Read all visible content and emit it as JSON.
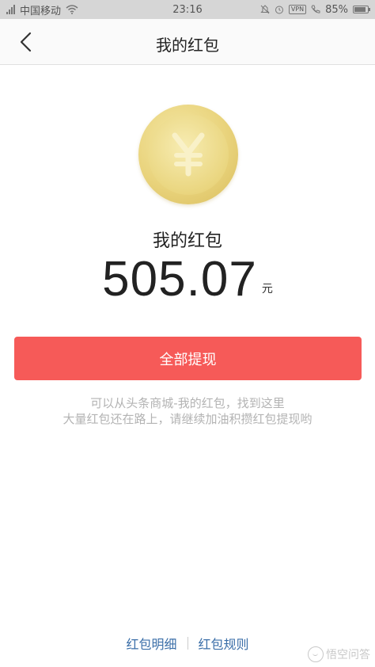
{
  "status_bar": {
    "carrier": "中国移动",
    "time": "23:16",
    "vpn": "VPN",
    "battery": "85%"
  },
  "nav": {
    "title": "我的红包"
  },
  "wallet": {
    "label": "我的红包",
    "amount": "505.07",
    "unit": "元",
    "withdraw_label": "全部提现"
  },
  "hint": {
    "line1": "可以从头条商城-我的红包，找到这里",
    "line2": "大量红包还在路上，请继续加油积攒红包提现哟"
  },
  "footer": {
    "details_link": "红包明细",
    "rules_link": "红包规则"
  },
  "watermark": {
    "text": "悟空问答"
  },
  "colors": {
    "accent_red": "#f65a58",
    "link_blue": "#3a6ea8",
    "coin_gold": "#e9d37c"
  }
}
